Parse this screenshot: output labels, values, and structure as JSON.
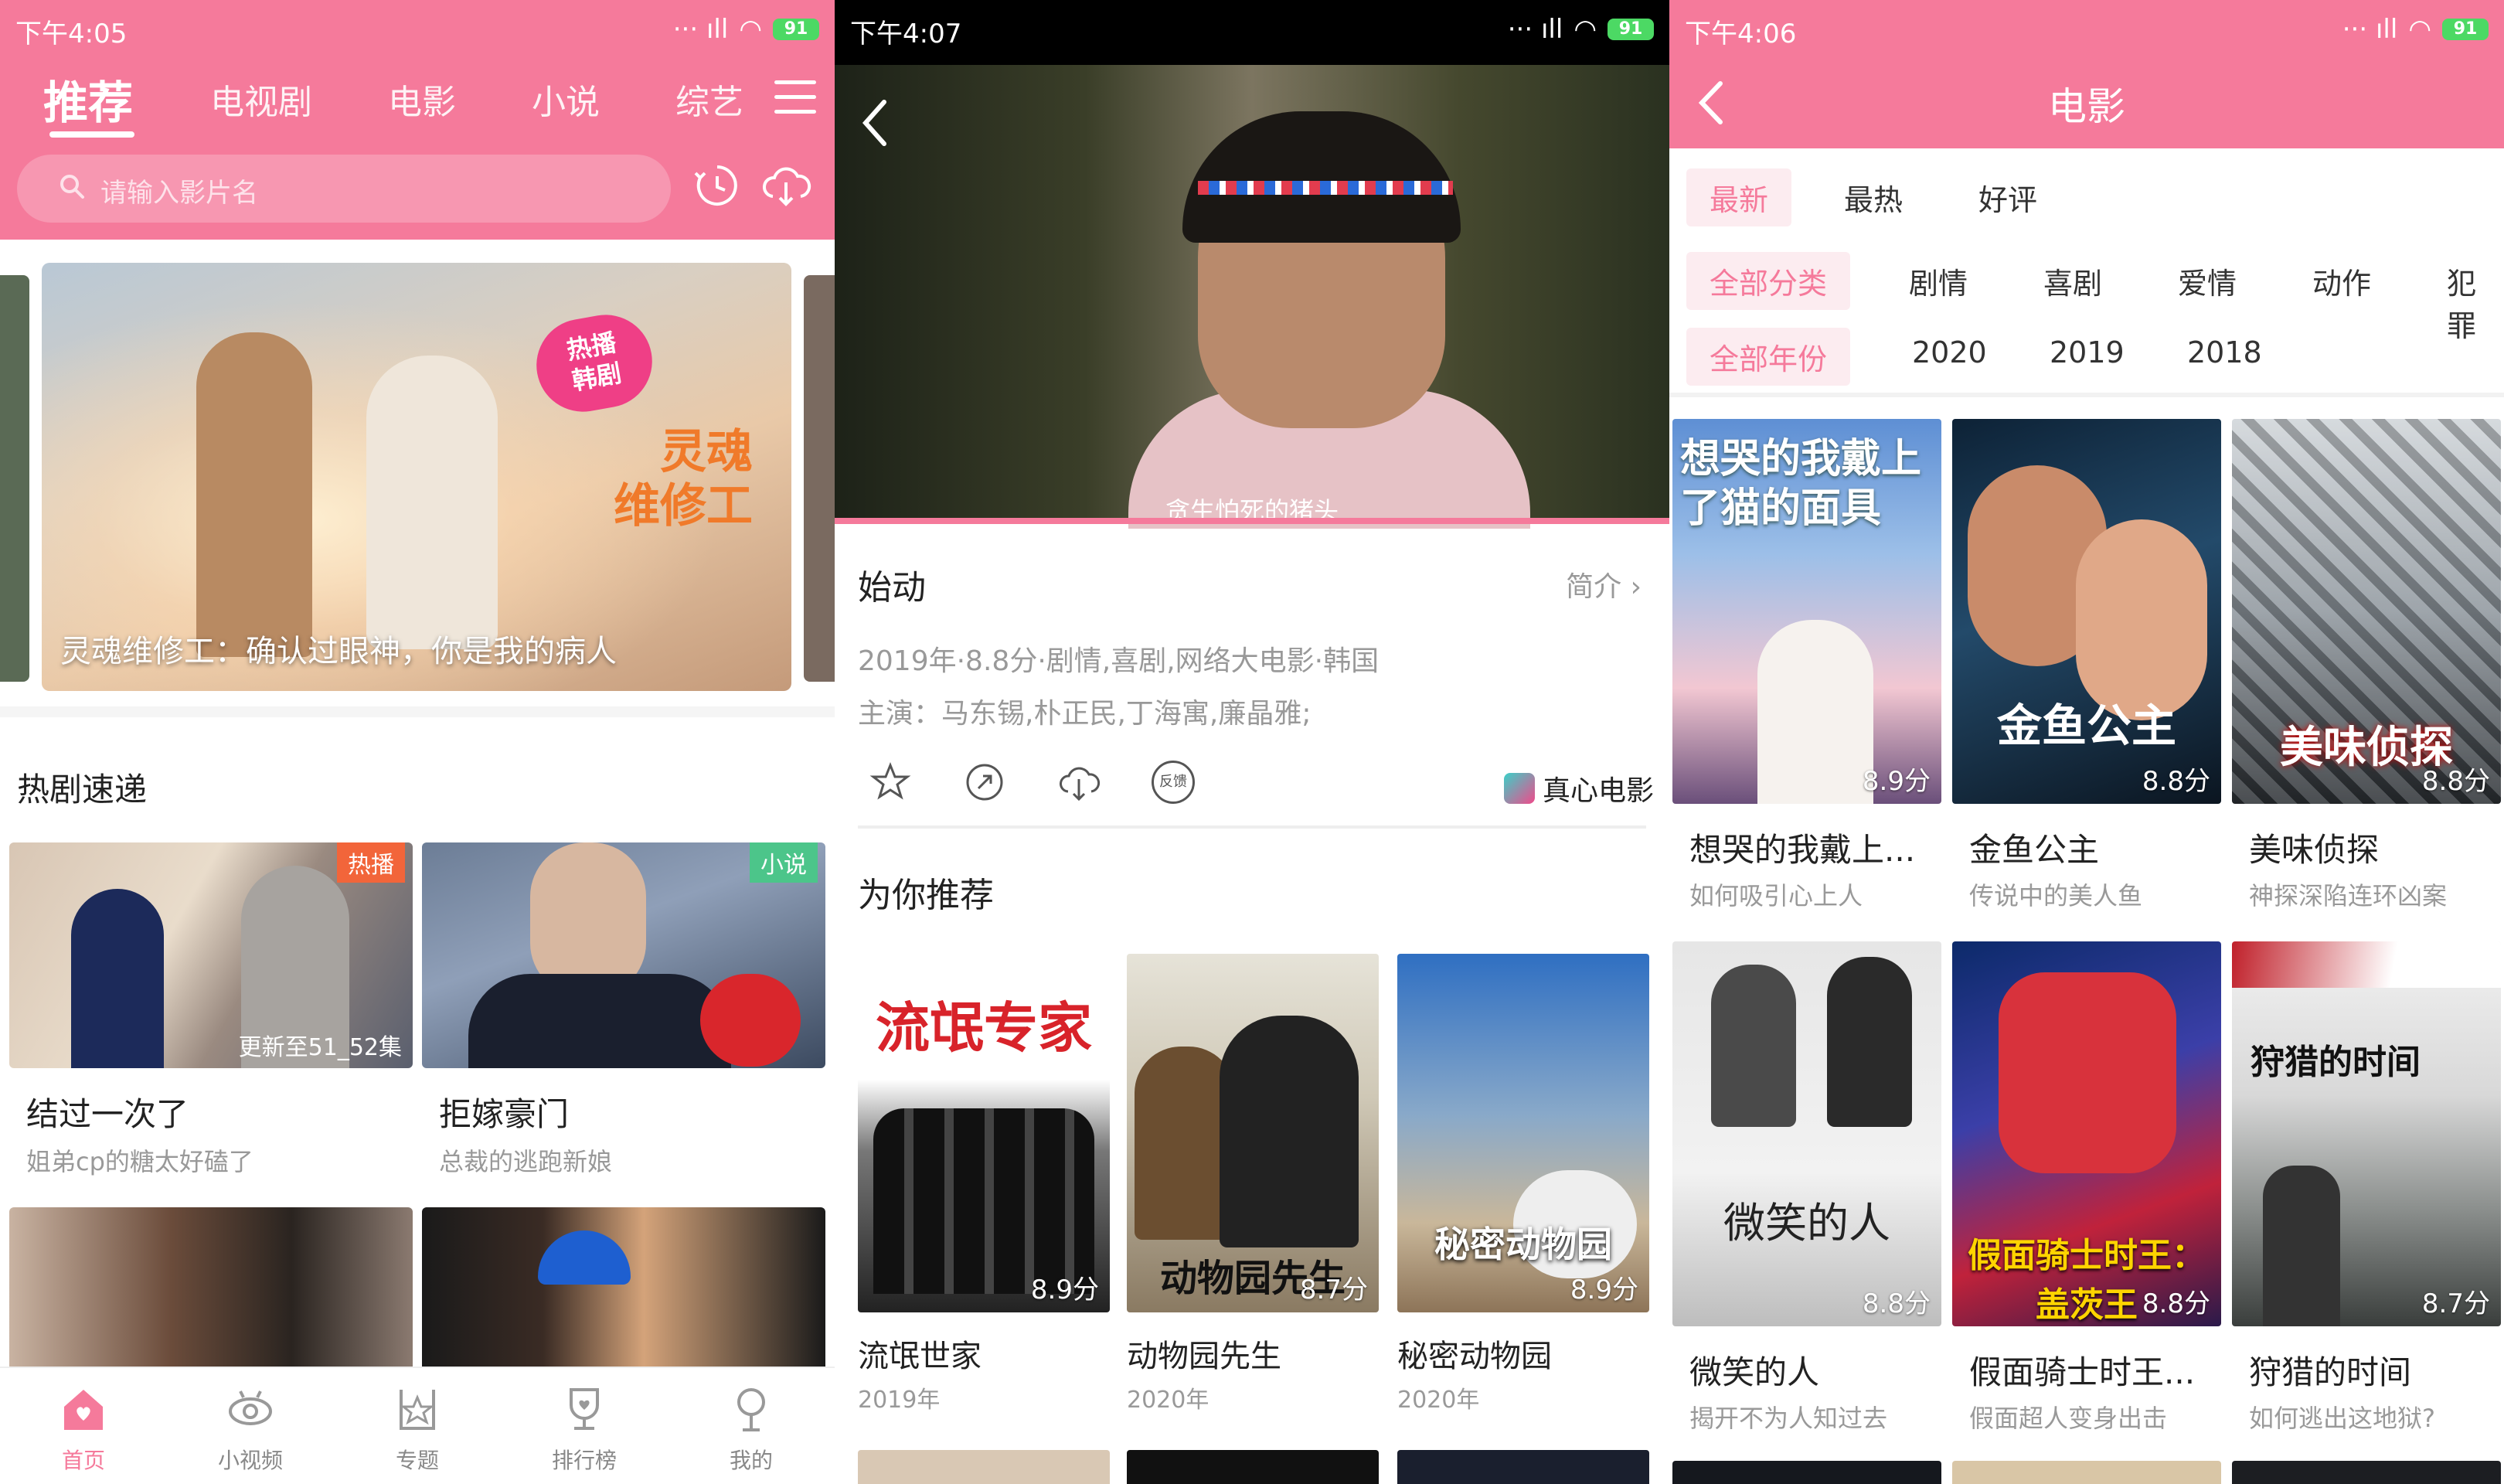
{
  "panel1": {
    "status_time": "下午4:05",
    "battery": "91",
    "tabs": [
      "推荐",
      "电视剧",
      "电影",
      "小说",
      "综艺"
    ],
    "search_placeholder": "请输入影片名",
    "banner": {
      "badge": "热播\n韩剧",
      "art_title": "灵魂\n维修工",
      "caption": "灵魂维修工：确认过眼神，你是我的病人"
    },
    "section_title": "热剧速递",
    "cards": [
      {
        "title": "结过一次了",
        "subtitle": "姐弟cp的糖太好磕了",
        "tag": "热播",
        "tag_color": "#f2653a",
        "update": "更新至51_52集"
      },
      {
        "title": "拒嫁豪门",
        "subtitle": "总裁的逃跑新娘",
        "tag": "小说",
        "tag_color": "#4cc58a",
        "update": ""
      }
    ],
    "nav": [
      {
        "label": "首页",
        "icon": "home-icon"
      },
      {
        "label": "小视频",
        "icon": "eye-icon"
      },
      {
        "label": "专题",
        "icon": "star-badge-icon"
      },
      {
        "label": "排行榜",
        "icon": "trophy-icon"
      },
      {
        "label": "我的",
        "icon": "person-icon"
      }
    ],
    "accent": "#f57a9b"
  },
  "panel2": {
    "status_time": "下午4:07",
    "battery": "91",
    "subtitle": "贪生怕死的猪头",
    "title": "始动",
    "intro_label": "简介",
    "meta": "2019年·8.8分·剧情,喜剧,网络大电影·韩国",
    "cast": "主演：马东锡,朴正民,丁海寓,廉晶雅;",
    "actions": [
      "star-icon",
      "share-icon",
      "download-icon",
      "feedback-icon"
    ],
    "feedback_label": "反馈",
    "brand": "真心电影",
    "recommend_title": "为你推荐",
    "posters": [
      {
        "title": "流氓世家",
        "year": "2019年",
        "score": "8.9分",
        "art": "流氓专家"
      },
      {
        "title": "动物园先生",
        "year": "2020年",
        "score": "8.7分",
        "art": "动物园先生"
      },
      {
        "title": "秘密动物园",
        "year": "2020年",
        "score": "8.9分",
        "art": "秘密动物园"
      }
    ]
  },
  "panel3": {
    "status_time": "下午4:06",
    "battery": "91",
    "title": "电影",
    "sort_options": [
      "最新",
      "最热",
      "好评"
    ],
    "categories": [
      "全部分类",
      "剧情",
      "喜剧",
      "爱情",
      "动作",
      "犯罪"
    ],
    "years": [
      "全部年份",
      "2020",
      "2019",
      "2018"
    ],
    "movies": [
      {
        "title": "想哭的我戴上...",
        "subtitle": "如何吸引心上人",
        "score": "8.9分",
        "art": "想哭的我戴上了猫的面具"
      },
      {
        "title": "金鱼公主",
        "subtitle": "传说中的美人鱼",
        "score": "8.8分",
        "art": "金鱼公主"
      },
      {
        "title": "美味侦探",
        "subtitle": "神探深陷连环凶案",
        "score": "8.8分",
        "art": "美味侦探"
      },
      {
        "title": "微笑的人",
        "subtitle": "揭开不为人知过去",
        "score": "8.8分",
        "art": "微笑的人"
      },
      {
        "title": "假面骑士时王...",
        "subtitle": "假面超人变身出击",
        "score": "8.8分",
        "art": "假面骑士时王：盖茨王"
      },
      {
        "title": "狩猎的时间",
        "subtitle": "如何逃出这地狱?",
        "score": "8.7分",
        "art": "狩猎的时间"
      }
    ]
  }
}
